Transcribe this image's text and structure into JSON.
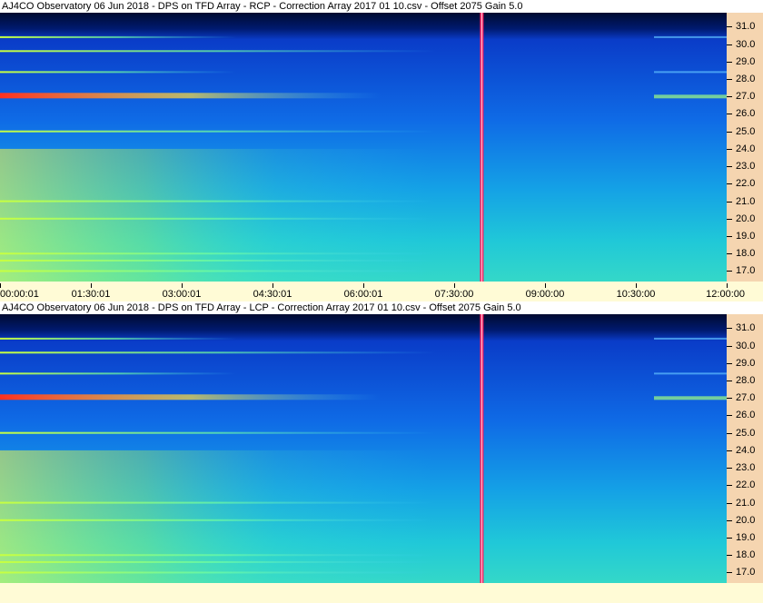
{
  "chart_data": [
    {
      "type": "heatmap",
      "title": "AJ4CO Observatory 06 Jun 2018  -  DPS on TFD Array  -  RCP  -  Correction Array 2017 01 10.csv  -  Offset 2075  Gain 5.0",
      "y_ticks": [
        "31.0",
        "30.0",
        "29.0",
        "28.0",
        "27.0",
        "26.0",
        "25.0",
        "24.0",
        "23.0",
        "22.0",
        "21.0",
        "20.0",
        "19.0",
        "18.0",
        "17.0"
      ],
      "x_ticks": [
        "00:00:01",
        "01:30:01",
        "03:00:01",
        "04:30:01",
        "06:00:01",
        "07:30:00",
        "09:00:00",
        "10:30:00",
        "12:00:00"
      ],
      "ylim": [
        16.4,
        31.8
      ],
      "bright_bands_mhz": [
        27.05,
        28.4,
        30.4,
        29.6,
        25.0,
        21.0,
        20.0,
        18.0,
        17.6,
        17.0
      ],
      "marker_time_fraction": 0.663
    },
    {
      "type": "heatmap",
      "title": "AJ4CO Observatory 06 Jun 2018  -  DPS on TFD Array  -  LCP  -  Correction Array 2017 01 10.csv  -  Offset 2075  Gain 5.0",
      "y_ticks": [
        "31.0",
        "30.0",
        "29.0",
        "28.0",
        "27.0",
        "26.0",
        "25.0",
        "24.0",
        "23.0",
        "22.0",
        "21.0",
        "20.0",
        "19.0",
        "18.0",
        "17.0"
      ],
      "ylim": [
        16.4,
        31.8
      ],
      "bright_bands_mhz": [
        27.05,
        28.4,
        30.4,
        29.6,
        25.0,
        21.0,
        20.0,
        18.0,
        17.6,
        17.0
      ],
      "marker_time_fraction": 0.663
    }
  ]
}
